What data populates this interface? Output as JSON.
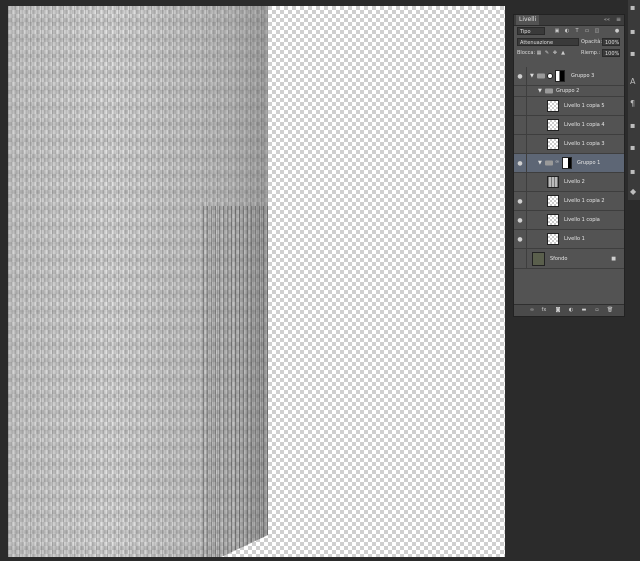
{
  "panel": {
    "tab": "Livelli",
    "collapse": "««",
    "menu": "≡",
    "filter_label": "Tipo",
    "blend_mode": "Attenuazione",
    "opacity_label": "Opacità:",
    "opacity_value": "100%",
    "lock_label": "Blocca:",
    "fill_label": "Riemp.:",
    "fill_value": "100%"
  },
  "layers": [
    {
      "name": "Gruppo 3",
      "type": "group-header",
      "visible": true
    },
    {
      "name": "Gruppo 2",
      "type": "group-sub",
      "visible": false
    },
    {
      "name": "Livello 1 copia 5",
      "type": "layer",
      "visible": false
    },
    {
      "name": "Livello 1 copia 4",
      "type": "layer",
      "visible": false
    },
    {
      "name": "Livello 1 copia 3",
      "type": "layer",
      "visible": false
    },
    {
      "name": "Gruppo 1",
      "type": "group-selected",
      "visible": true
    },
    {
      "name": "Livello 2",
      "type": "layer",
      "visible": false
    },
    {
      "name": "Livello 1 copia 2",
      "type": "layer",
      "visible": true
    },
    {
      "name": "Livello 1 copia",
      "type": "layer",
      "visible": true
    },
    {
      "name": "Livello 1",
      "type": "layer",
      "visible": true
    },
    {
      "name": "Sfondo",
      "type": "background",
      "visible": false
    }
  ],
  "icons": {
    "eye": "👁",
    "expand": "▼",
    "lock": "🔒",
    "chain": "∞"
  },
  "colors": {
    "panel_bg": "#535353",
    "selected_row": "#5d6675",
    "app_bg": "#2b2b2b"
  }
}
